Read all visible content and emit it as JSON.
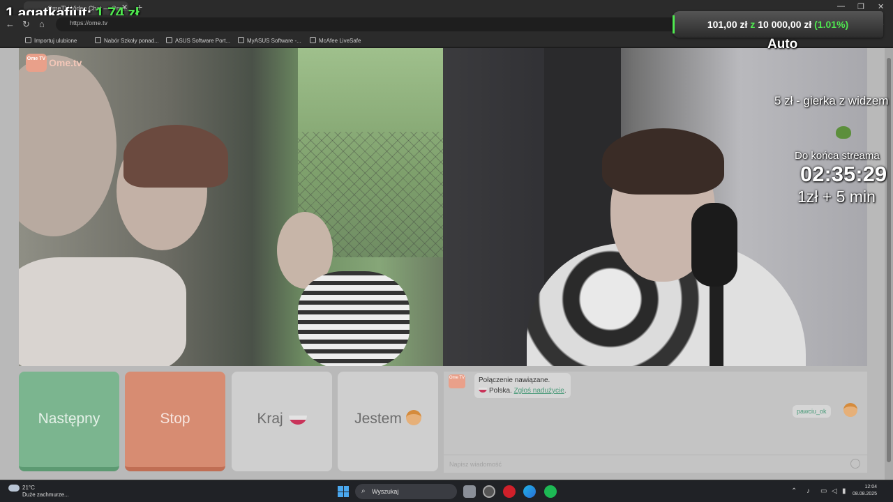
{
  "browser": {
    "tab_title": "OmeTV Video Chat — Ome...",
    "url": "https://ome.tv",
    "bookmarks": [
      "Importuj ulubione",
      "Nabór Szkoły ponad...",
      "ASUS Software Port...",
      "MyASUS Software -...",
      "McAfee LiveSafe"
    ]
  },
  "stream_overlay": {
    "top_donor_prefix": "1.agatkafiut: ",
    "top_donor_amount": "1,74 zł",
    "mode_label": "Auto",
    "goal_current": "101,00 zł",
    "goal_separator": "z",
    "goal_target": "10 000,00 zł",
    "goal_percent": "(1.01%)",
    "promo_text": "5 zł - gierka z widzem",
    "countdown_label": "Do końca streama",
    "countdown_value": "02:35:29",
    "time_rate": "1zł + 5 min"
  },
  "site": {
    "logo_text": "Ome.tv",
    "logo_badge": "Ome TV"
  },
  "controls": {
    "next_label": "Następny",
    "stop_label": "Stop",
    "country_label": "Kraj",
    "me_label": "Jestem"
  },
  "chat": {
    "system_line1": "Połączenie nawiązane.",
    "system_country": "Polska.",
    "report_link": "Zgłoś nadużycie",
    "report_suffix": ".",
    "username": "pawciu_ok",
    "input_placeholder": "Napisz wiadomość"
  },
  "taskbar": {
    "temperature": "21°C",
    "weather": "Duże zachmurze...",
    "search_label": "Wyszukaj",
    "time": "12:04",
    "date": "08.08.2025"
  },
  "colors": {
    "accent_green": "#4fe84f",
    "next_button": "#7bb58f",
    "stop_button": "#d78c72",
    "link": "#4a9a79"
  }
}
